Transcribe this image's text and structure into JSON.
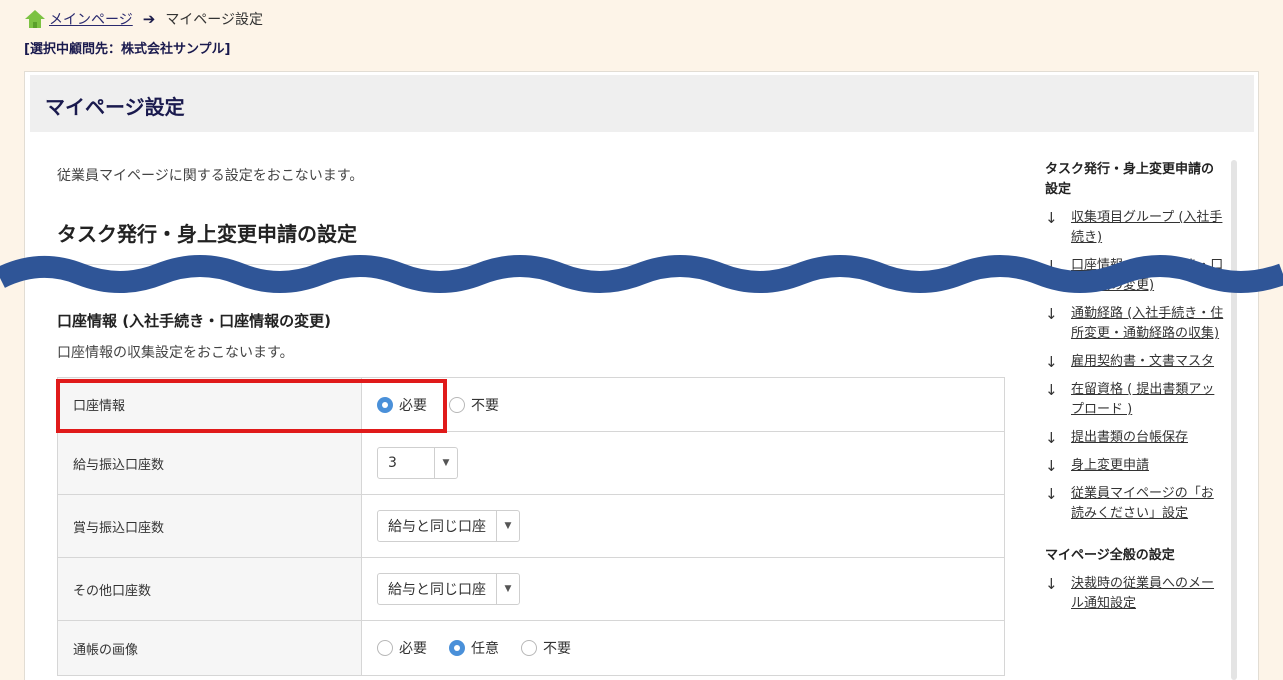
{
  "breadcrumb": {
    "home_icon": "home-icon",
    "main_page": "メインページ",
    "separator": "➔",
    "current": "マイページ設定"
  },
  "selected_client": "[選択中顧問先：株式会社サンプル]",
  "page_title": "マイページ設定",
  "intro": "従業員マイページに関する設定をおこないます。",
  "section_title": "タスク発行・身上変更申請の設定",
  "subsection": {
    "title": "口座情報 (入社手続き・口座情報の変更)",
    "description": "口座情報の収集設定をおこないます。"
  },
  "settings": {
    "rows": [
      {
        "label": "口座情報",
        "type": "radio",
        "options": [
          "必要",
          "不要"
        ],
        "selected": "必要"
      },
      {
        "label": "給与振込口座数",
        "type": "select",
        "value": "3"
      },
      {
        "label": "賞与振込口座数",
        "type": "select",
        "value": "給与と同じ口座"
      },
      {
        "label": "その他口座数",
        "type": "select",
        "value": "給与と同じ口座"
      },
      {
        "label": "通帳の画像",
        "type": "radio",
        "options": [
          "必要",
          "任意",
          "不要"
        ],
        "selected": "任意"
      }
    ]
  },
  "toc": {
    "heading1": "タスク発行・身上変更申請の設定",
    "items1": [
      "収集項目グループ (入社手続き)",
      "口座情報 (入社手続き・口座情報の変更)",
      "通勤経路 (入社手続き・住所変更・通勤経路の収集)",
      "雇用契約書・文書マスタ",
      "在留資格 ( 提出書類アップロード )",
      "提出書類の台帳保存",
      "身上変更申請",
      "従業員マイページの「お読みください」設定"
    ],
    "heading2": "マイページ全般の設定",
    "items2": [
      "決裁時の従業員へのメール通知設定"
    ]
  },
  "colors": {
    "background": "#fdf4e8",
    "title_navy": "#1a1a4e",
    "highlight_red": "#e01a1a",
    "radio_blue": "#4a90d9",
    "wave_blue": "#2f5597"
  }
}
